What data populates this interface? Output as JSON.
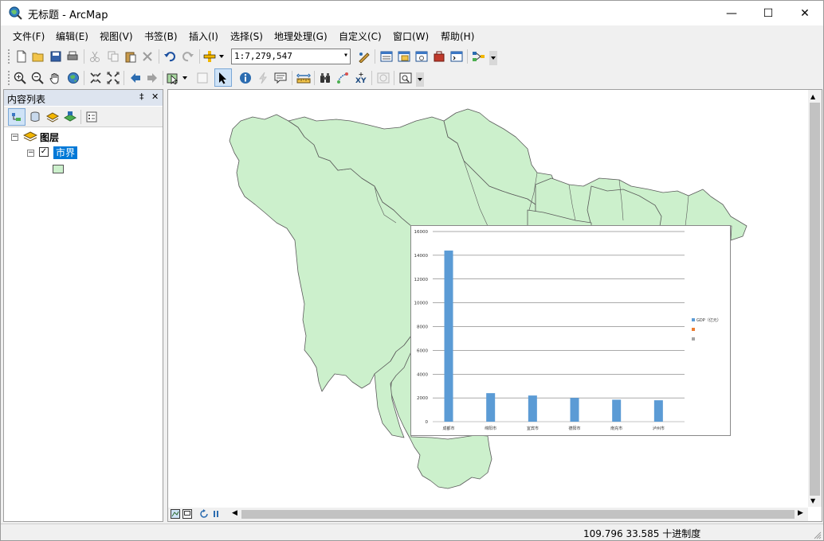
{
  "window": {
    "title": "无标题 - ArcMap",
    "minimize": "—",
    "maximize": "☐",
    "close": "✕"
  },
  "menu": [
    "文件(F)",
    "编辑(E)",
    "视图(V)",
    "书签(B)",
    "插入(I)",
    "选择(S)",
    "地理处理(G)",
    "自定义(C)",
    "窗口(W)",
    "帮助(H)"
  ],
  "toolbar": {
    "scale": "1:7,279,547"
  },
  "toc": {
    "title": "内容列表",
    "pin": "‡",
    "close": "✕",
    "root_layer": "图层",
    "layer": "市界",
    "layer_checked": true,
    "expander_symbol": "−"
  },
  "chart_data": {
    "type": "bar",
    "categories": [
      "成都市",
      "绵阳市",
      "宜宾市",
      "德阳市",
      "南充市",
      "泸州市"
    ],
    "series": [
      {
        "name": "GDP（亿元）",
        "values": [
          14400,
          2400,
          2200,
          2000,
          1850,
          1800
        ],
        "color": "#5b9bd5"
      },
      {
        "name": "",
        "values": [
          0,
          0,
          0,
          0,
          0,
          0
        ],
        "color": "#ed7d31"
      },
      {
        "name": "",
        "values": [
          0,
          0,
          0,
          0,
          0,
          0
        ],
        "color": "#a5a5a5"
      }
    ],
    "yticks": [
      "0",
      "2000",
      "4000",
      "6000",
      "8000",
      "10000",
      "12000",
      "14000",
      "16000"
    ],
    "ylim": [
      0,
      16000
    ],
    "grid": true,
    "legend_position": "right"
  },
  "colors": {
    "map_fill": "#ccf0cc",
    "map_stroke": "#5a5a5a",
    "selection": "#0078d7",
    "toc_header": "#dde4ef"
  },
  "status": {
    "coords": "109.796  33.585 十进制度"
  }
}
